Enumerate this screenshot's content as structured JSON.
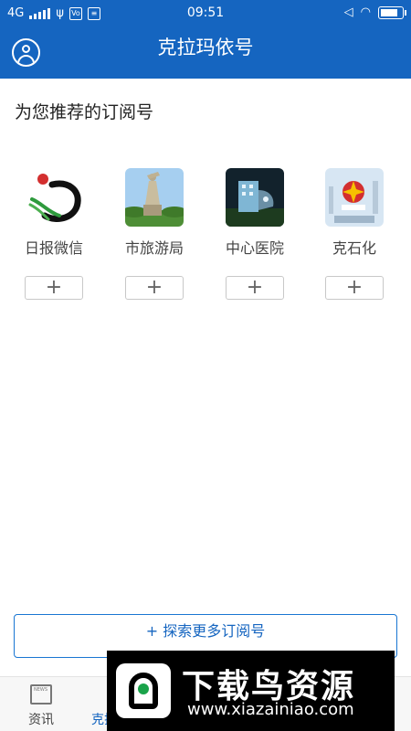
{
  "status_bar": {
    "network": "4G",
    "time": "09:51",
    "icons": [
      "usb-icon",
      "volte-icon",
      "data-icon",
      "mute-icon",
      "wifi-icon",
      "battery-icon"
    ]
  },
  "header": {
    "title": "克拉玛依号",
    "avatar_icon": "user-avatar-icon"
  },
  "section": {
    "title": "为您推荐的订阅号"
  },
  "subscriptions": [
    {
      "name": "日报微信",
      "add_label": "+"
    },
    {
      "name": "市旅游局",
      "add_label": "+"
    },
    {
      "name": "中心医院",
      "add_label": "+"
    },
    {
      "name": "克石化",
      "add_label": "+"
    }
  ],
  "explore_button": "+ 探索更多订阅号",
  "tabs": [
    {
      "label": "资讯",
      "icon": "news-icon",
      "active": false
    },
    {
      "label": "克拉玛依号",
      "icon": "subscription-icon",
      "active": true
    },
    {
      "label": "",
      "icon": "",
      "active": false
    },
    {
      "label": "",
      "icon": "",
      "active": false
    },
    {
      "label": "",
      "icon": "",
      "active": false
    }
  ],
  "watermark": {
    "title": "下载鸟资源",
    "url": "www.xiazainiao.com"
  },
  "colors": {
    "primary": "#1565c0",
    "tab_active": "#1565c0"
  }
}
